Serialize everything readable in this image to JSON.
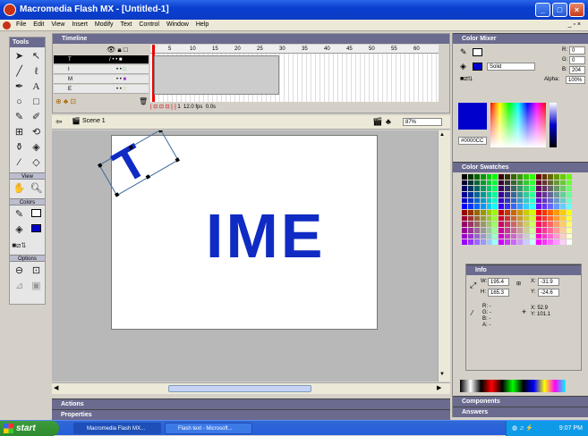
{
  "window": {
    "title": "Macromedia Flash MX - [Untitled-1]"
  },
  "menu": [
    "File",
    "Edit",
    "View",
    "Insert",
    "Modify",
    "Text",
    "Control",
    "Window",
    "Help"
  ],
  "tools": {
    "header": "Tools",
    "view_label": "View",
    "colors_label": "Colors",
    "options_label": "Options"
  },
  "timeline": {
    "header": "Timeline",
    "layers": [
      {
        "name": "T"
      },
      {
        "name": "I"
      },
      {
        "name": "M"
      },
      {
        "name": "E"
      }
    ],
    "frame_numbers": [
      "5",
      "10",
      "15",
      "20",
      "25",
      "30",
      "35",
      "40",
      "45",
      "50",
      "55",
      "60"
    ],
    "status": {
      "frame": "1",
      "fps": "12.0 fps",
      "time": "0.0s"
    }
  },
  "stage": {
    "scene": "Scene 1",
    "zoom": "87%",
    "text_ime": "IME",
    "text_t": "T"
  },
  "color_mixer": {
    "header": "Color Mixer",
    "fill": "Solid",
    "R": "0",
    "G": "0",
    "B": "204",
    "alpha": "100%",
    "hex": "#0000CC",
    "alpha_label": "Alpha:"
  },
  "swatches": {
    "header": "Color Swatches"
  },
  "info": {
    "header": "Info",
    "W": "195.4",
    "H": "165.3",
    "X": "-31.9",
    "Y": "-24.6",
    "R": "R: -",
    "G": "G: -",
    "B": "B: -",
    "A": "A: -",
    "mx": "X: 52.9",
    "my": "Y: 101.1"
  },
  "panels": {
    "components": "Components",
    "answers": "Answers",
    "actions": "Actions",
    "properties": "Properties"
  },
  "taskbar": {
    "start": "start",
    "tasks": [
      "Macromedia Flash MX...",
      "Flash text - Microsoft..."
    ],
    "time": "9:07 PM"
  },
  "colors": {
    "accent": "#0000CC",
    "panel_header": "#6b6b8f",
    "title": "#0a3fcf"
  }
}
